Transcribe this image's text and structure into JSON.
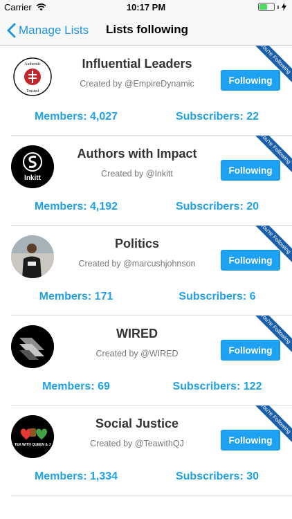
{
  "status_bar": {
    "carrier": "Carrier",
    "time": "10:17 PM"
  },
  "nav": {
    "back_label": "Manage Lists",
    "title": "Lists following"
  },
  "lists": [
    {
      "title": "Influential Leaders",
      "creator": "Created by @EmpireDynamic",
      "button": "Following",
      "ribbon": "You're Following",
      "members": "Members: 4,027",
      "subscribers": "Subscribers: 22",
      "avatar_text": "Authentic",
      "avatar_sub": "Trusted"
    },
    {
      "title": "Authors with Impact",
      "creator": "Created by @Inkitt",
      "button": "Following",
      "ribbon": "You're Following",
      "members": "Members: 4,192",
      "subscribers": "Subscribers: 20",
      "avatar_text": "Inkitt"
    },
    {
      "title": "Politics",
      "creator": "Created by @marcushjohnson",
      "button": "Following",
      "ribbon": "You're Following",
      "members": "Members: 171",
      "subscribers": "Subscribers: 6"
    },
    {
      "title": "WIRED",
      "creator": "Created by @WIRED",
      "button": "Following",
      "ribbon": "You're Following",
      "members": "Members: 69",
      "subscribers": "Subscribers: 122"
    },
    {
      "title": "Social Justice",
      "creator": "Created by @TeawithQJ",
      "button": "Following",
      "ribbon": "You're Following",
      "members": "Members: 1,334",
      "subscribers": "Subscribers: 30",
      "avatar_text": "TEA WITH QUEEN & J"
    }
  ],
  "colors": {
    "accent": "#1da1f2",
    "stat": "#1fa1e8",
    "ribbon": "#1a5fa8",
    "battery": "#4cd964"
  },
  "icons": {
    "wifi": "wifi-icon",
    "back": "chevron-left-icon",
    "charging": "bolt-icon"
  }
}
